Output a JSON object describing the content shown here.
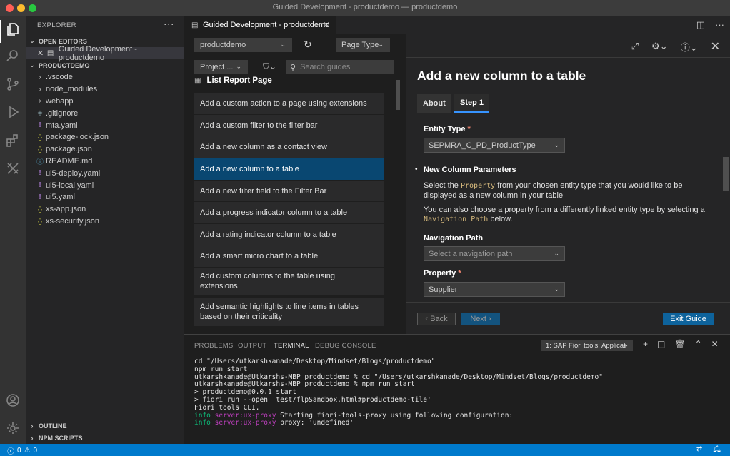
{
  "window": {
    "title": "Guided Development - productdemo — productdemo"
  },
  "sidebar": {
    "header": "EXPLORER",
    "open_editors_title": "OPEN EDITORS",
    "open_editor_file": "Guided Development - productdemo",
    "project_title": "PRODUCTDEMO",
    "files": [
      {
        "name": ".vscode",
        "icon": "chevron-right-icon"
      },
      {
        "name": "node_modules",
        "icon": "chevron-right-icon"
      },
      {
        "name": "webapp",
        "icon": "chevron-right-icon"
      },
      {
        "name": ".gitignore",
        "icon": "git-icon"
      },
      {
        "name": "mta.yaml",
        "icon": "yaml-icon"
      },
      {
        "name": "package-lock.json",
        "icon": "json-icon"
      },
      {
        "name": "package.json",
        "icon": "json-icon"
      },
      {
        "name": "README.md",
        "icon": "markdown-icon"
      },
      {
        "name": "ui5-deploy.yaml",
        "icon": "yaml-icon"
      },
      {
        "name": "ui5-local.yaml",
        "icon": "yaml-icon"
      },
      {
        "name": "ui5.yaml",
        "icon": "yaml-icon"
      },
      {
        "name": "xs-app.json",
        "icon": "json-icon"
      },
      {
        "name": "xs-security.json",
        "icon": "json-icon"
      }
    ],
    "outline_title": "OUTLINE",
    "npm_scripts_title": "NPM SCRIPTS"
  },
  "editor": {
    "tab_label": "Guided Development - productdemo"
  },
  "guided_left": {
    "project_select": "productdemo",
    "page_type_select": "Page Type",
    "project_filter_select": "Project ...",
    "search_placeholder": "Search guides",
    "group_title": "List Report Page",
    "guides": [
      "Add a custom action to a page using extensions",
      "Add a custom filter to the filter bar",
      "Add a new column as a contact view",
      "Add a new column to a table",
      "Add a new filter field to the Filter Bar",
      "Add a progress indicator column to a table",
      "Add a rating indicator column to a table",
      "Add a smart micro chart to a table",
      "Add custom columns to the table using extensions",
      "Add semantic highlights to line items in tables based on their criticality"
    ],
    "selected_guide": "Add a new column to a table"
  },
  "guided_right": {
    "title": "Add a new column to a table",
    "tabs": [
      "About",
      "Step 1"
    ],
    "active_tab": "Step 1",
    "entity_type_label": "Entity Type",
    "entity_type_value": "SEPMRA_C_PD_ProductType",
    "section_title": "New Column Parameters",
    "para1_a": "Select the ",
    "para1_code": "Property",
    "para1_b": " from your chosen entity type that you would like to be displayed as a new column in your table",
    "para2_a": "You can also choose a property from a differently linked entity type by selecting a ",
    "para2_code": "Navigation Path",
    "para2_b": " below.",
    "nav_path_label": "Navigation Path",
    "nav_path_placeholder": "Select a navigation path",
    "property_label": "Property",
    "property_value": "Supplier",
    "required_mark": "*",
    "back_label": "Back",
    "next_label": "Next",
    "exit_label": "Exit Guide"
  },
  "panel": {
    "tabs": [
      "PROBLEMS",
      "OUTPUT",
      "TERMINAL",
      "DEBUG CONSOLE"
    ],
    "active_tab": "TERMINAL",
    "terminal_select": "1: SAP Fiori tools: Applicat",
    "lines": [
      "cd \"/Users/utkarshkanade/Desktop/Mindset/Blogs/productdemo\"",
      "npm run start",
      "utkarshkanade@Utkarshs-MBP productdemo % cd \"/Users/utkarshkanade/Desktop/Mindset/Blogs/productdemo\"",
      "utkarshkanade@Utkarshs-MBP productdemo % npm run start",
      "",
      "> productdemo@0.0.1 start",
      "> fiori run --open 'test/flpSandbox.html#productdemo-tile'",
      "",
      "Fiori tools CLI."
    ],
    "log_lines": [
      {
        "level": "info",
        "source": "server:ux-proxy",
        "message": "Starting fiori-tools-proxy using following configuration:"
      },
      {
        "level": "info",
        "source": "server:ux-proxy",
        "message": "proxy: 'undefined'"
      }
    ]
  },
  "statusbar": {
    "errors": "0",
    "warnings": "0"
  },
  "colors": {
    "accent": "#007acc",
    "selection": "#094771",
    "required": "#f48771"
  }
}
